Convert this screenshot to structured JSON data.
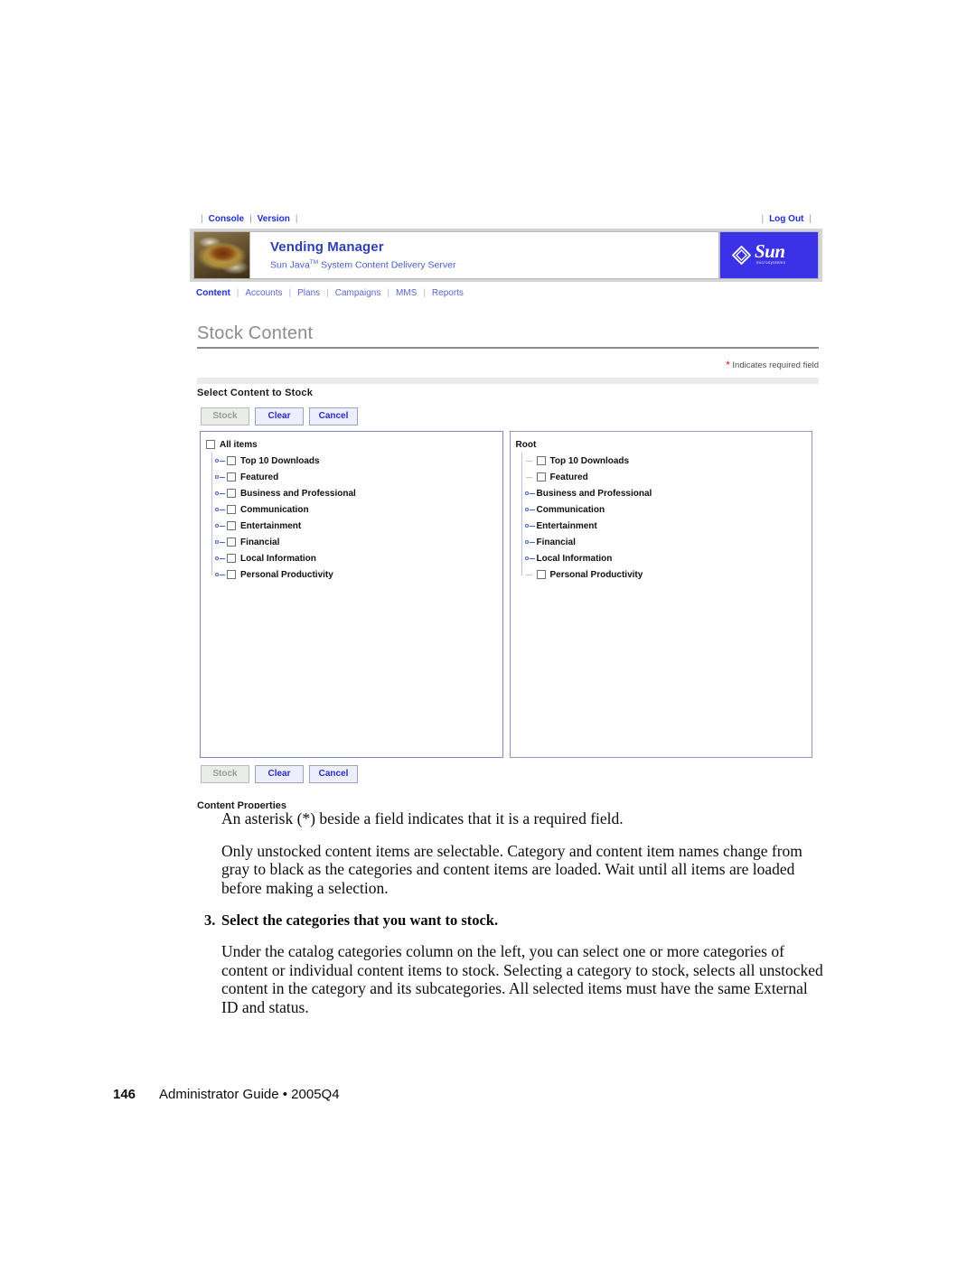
{
  "app": {
    "utility": {
      "left_links": [
        "Console",
        "Version"
      ],
      "right_links": [
        "Log Out"
      ],
      "separator": "|"
    },
    "brand": {
      "title": "Vending Manager",
      "subtitle_pre": "Sun Java",
      "subtitle_tm": "TM",
      "subtitle_post": " System Content Delivery Server",
      "logo_word": "Sun",
      "logo_micro": "microsystems",
      "logo_bg": "#3b32e8"
    },
    "nav": {
      "items": [
        {
          "label": "Content",
          "active": true
        },
        {
          "label": "Accounts",
          "active": false
        },
        {
          "label": "Plans",
          "active": false
        },
        {
          "label": "Campaigns",
          "active": false
        },
        {
          "label": "MMS",
          "active": false
        },
        {
          "label": "Reports",
          "active": false
        }
      ],
      "separator": "|"
    },
    "page": {
      "title": "Stock Content",
      "required_star": "*",
      "required_note": "Indicates required field",
      "section_heading": "Select Content to Stock",
      "clipped_heading": "Content Properties"
    },
    "buttons": {
      "stock": "Stock",
      "clear": "Clear",
      "cancel": "Cancel"
    },
    "left_tree": {
      "root_label": "All items",
      "root_has_checkbox": true,
      "items": [
        {
          "label": "Top 10 Downloads",
          "handle": "key",
          "checkbox": true
        },
        {
          "label": "Featured",
          "handle": "key",
          "checkbox": true
        },
        {
          "label": "Business and Professional",
          "handle": "key",
          "checkbox": true
        },
        {
          "label": "Communication",
          "handle": "key",
          "checkbox": true
        },
        {
          "label": "Entertainment",
          "handle": "key",
          "checkbox": true
        },
        {
          "label": "Financial",
          "handle": "key",
          "checkbox": true
        },
        {
          "label": "Local Information",
          "handle": "key",
          "checkbox": true
        },
        {
          "label": "Personal Productivity",
          "handle": "key",
          "checkbox": true
        }
      ]
    },
    "right_tree": {
      "root_label": "Root",
      "root_has_checkbox": false,
      "items": [
        {
          "label": "Top 10 Downloads",
          "handle": "line",
          "checkbox": true
        },
        {
          "label": "Featured",
          "handle": "line",
          "checkbox": true
        },
        {
          "label": "Business and Professional",
          "handle": "key",
          "checkbox": false
        },
        {
          "label": "Communication",
          "handle": "key",
          "checkbox": false
        },
        {
          "label": "Entertainment",
          "handle": "key",
          "checkbox": false
        },
        {
          "label": "Financial",
          "handle": "key",
          "checkbox": false
        },
        {
          "label": "Local Information",
          "handle": "key",
          "checkbox": false
        },
        {
          "label": "Personal Productivity",
          "handle": "line",
          "checkbox": true
        }
      ]
    }
  },
  "document": {
    "paragraph_1": "An asterisk (*) beside a field indicates that it is a required field.",
    "paragraph_2": "Only unstocked content items are selectable. Category and content item names change from gray to black as the categories and content items are loaded. Wait until all items are loaded before making a selection.",
    "step_number": "3.",
    "step_title": "Select the categories that you want to stock.",
    "paragraph_3": "Under the catalog categories column on the left, you can select one or more categories of content or individual content items to stock. Selecting a category to stock, selects all unstocked content in the category and its subcategories. All selected items must have the same External ID and status."
  },
  "footer": {
    "page_number": "146",
    "text": "Administrator Guide • 2005Q4"
  }
}
